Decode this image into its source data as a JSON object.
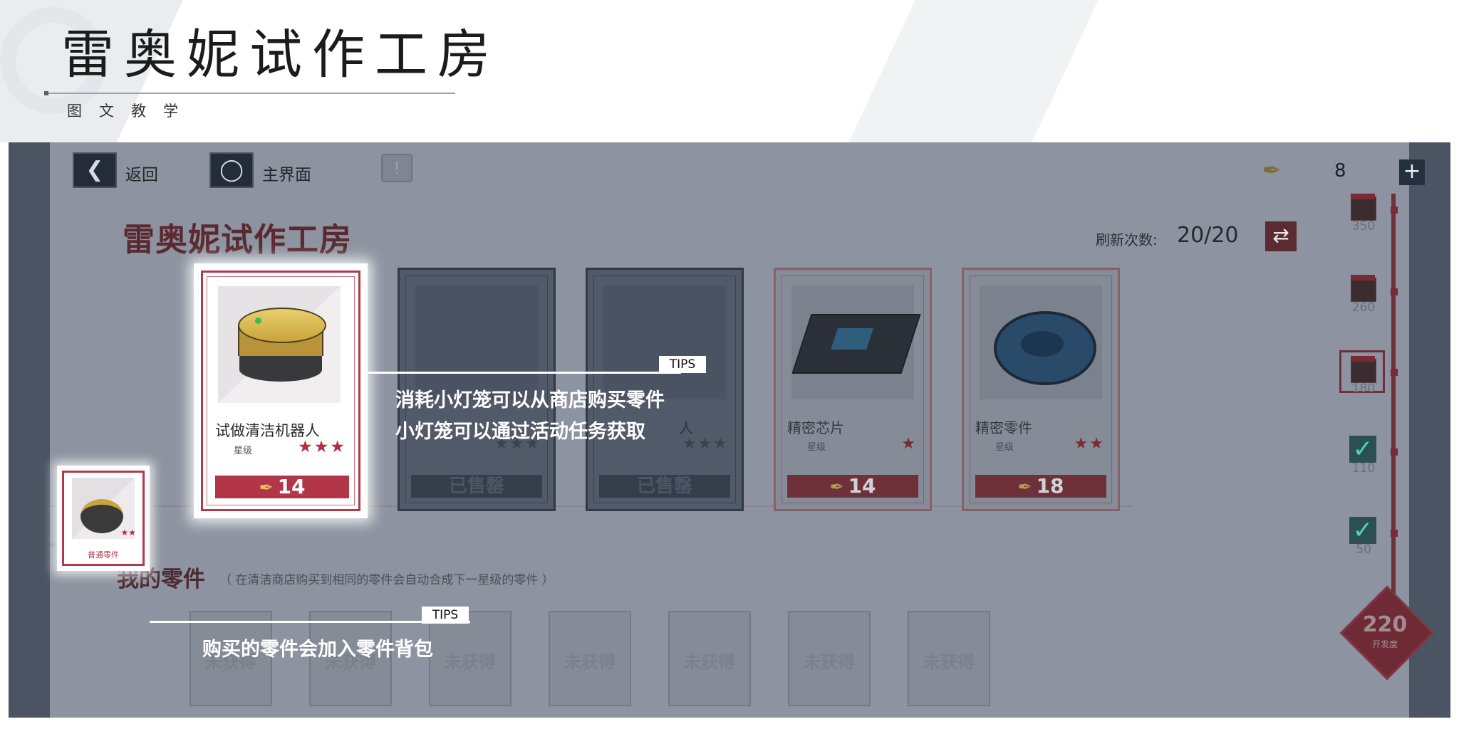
{
  "slide": {
    "title": "雷奥妮试作工房",
    "subtitle": "图文教学"
  },
  "game": {
    "topbar": {
      "back_label": "返回",
      "home_label": "主界面",
      "currency_value": "8",
      "add_icon": "plus-icon"
    },
    "title": "雷奥妮试作工房",
    "refresh": {
      "label": "刷新次数:",
      "value": "20/20"
    },
    "shop_cards": [
      {
        "name": "试做清洁机器人",
        "rank_label": "星级",
        "stars": "★★★",
        "price": "14",
        "state": "highlighted"
      },
      {
        "name": "",
        "rank_label": "",
        "stars": "★★★",
        "price": "已售罄",
        "state": "sold"
      },
      {
        "name": "人",
        "rank_label": "",
        "stars": "★★★",
        "price": "已售罄",
        "state": "sold"
      },
      {
        "name": "精密芯片",
        "rank_label": "星级",
        "stars": "★",
        "price": "14",
        "state": "dim"
      },
      {
        "name": "精密零件",
        "rank_label": "星级",
        "stars": "★★",
        "price": "18",
        "state": "dim"
      }
    ],
    "parts": {
      "title": "我的零件",
      "note": "（ 在清洁商店购买到相同的零件会自动合成下一星级的零件 ）",
      "owned": {
        "stars": "★★",
        "label": "普通零件"
      },
      "empty_slot_label": "未获得",
      "empty_slots": 7
    },
    "rail": {
      "milestones": [
        {
          "value": "350",
          "state": "locked"
        },
        {
          "value": "260",
          "state": "locked"
        },
        {
          "value": "180",
          "state": "current"
        },
        {
          "value": "110",
          "state": "claimed"
        },
        {
          "value": "50",
          "state": "claimed"
        }
      ],
      "score_value": "220",
      "score_label": "开发度"
    }
  },
  "tips": {
    "tag": "TIPS",
    "shop_line1": "消耗小灯笼可以从商店购买零件",
    "shop_line2": "小灯笼可以通过活动任务获取",
    "parts_line": "购买的零件会加入零件背包"
  },
  "colors": {
    "accent_red": "#b2394a",
    "overlay_gray": "#8d93a0",
    "frame_dark": "#4a5462"
  }
}
